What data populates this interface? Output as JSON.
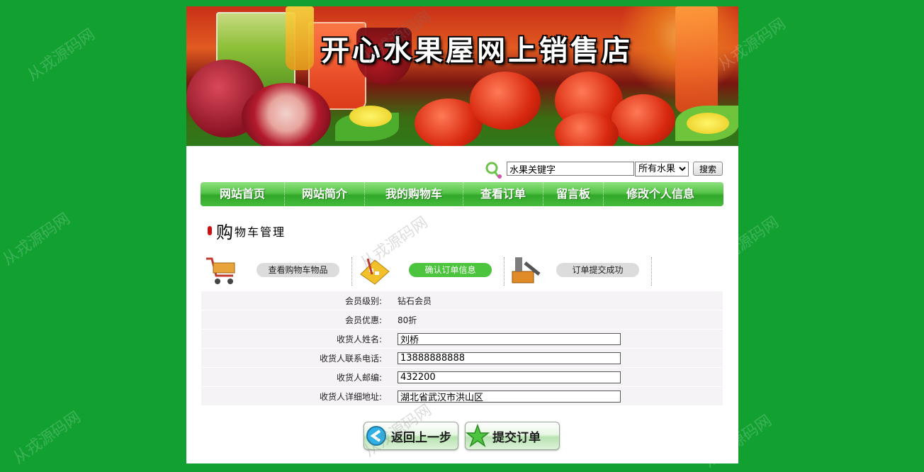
{
  "banner": {
    "title": "开心水果屋网上销售店"
  },
  "search": {
    "keyword": "水果关键字",
    "category": "所有水果",
    "button_label": "搜索"
  },
  "nav": {
    "items": [
      "网站首页",
      "网站简介",
      "我的购物车",
      "查看订单",
      "留言板",
      "修改个人信息"
    ]
  },
  "section": {
    "title_big": "购",
    "title_rest": "物车管理"
  },
  "steps": [
    {
      "label": "查看购物车物品",
      "icon": "shopping-cart-icon",
      "active": false
    },
    {
      "label": "确认订单信息",
      "icon": "calculator-icon",
      "active": true
    },
    {
      "label": "订单提交成功",
      "icon": "tools-box-icon",
      "active": false
    }
  ],
  "form": {
    "member_level_label": "会员级别:",
    "member_level": "钻石会员",
    "member_discount_label": "会员优惠:",
    "member_discount": "80折",
    "name_label": "收货人姓名:",
    "name": "刘桥",
    "phone_label": "收货人联系电话:",
    "phone": "13888888888",
    "zip_label": "收货人邮编:",
    "zip": "432200",
    "address_label": "收货人详细地址:",
    "address": "湖北省武汉市洪山区"
  },
  "actions": {
    "back_label": "返回上一步",
    "submit_label": "提交订单"
  },
  "watermark": "从戎源码网",
  "colors": {
    "background": "#12a131",
    "nav": "#46bb3c",
    "accent": "#4cc43d"
  }
}
